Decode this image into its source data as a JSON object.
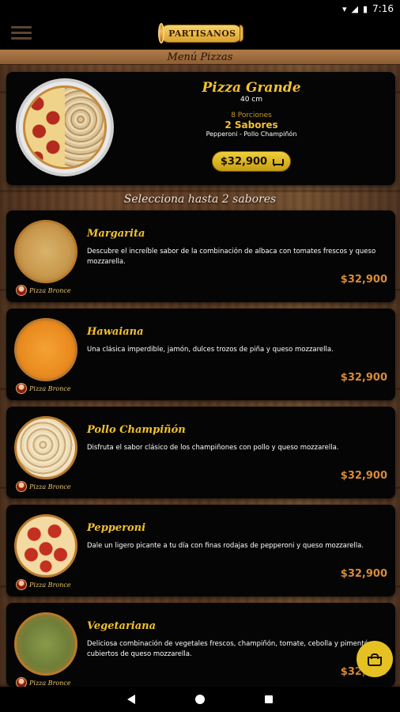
{
  "status_bar": {
    "time": "7:16"
  },
  "app_bar": {
    "logo_text": "PARTISANOS"
  },
  "section_title": "Menú Pizzas",
  "header": {
    "title": "Pizza Grande",
    "size": "40 cm",
    "portions": "8 Porciones",
    "flavors": "2 Sabores",
    "selected": "Pepperoni - Pollo Champiñón",
    "price": "$32,900"
  },
  "select_title": "Selecciona hasta 2 sabores",
  "products": [
    {
      "name": "Margarita",
      "description": "Descubre el increíble sabor de la combinación de albaca con tomates frescos y queso mozzarella.",
      "price": "$32,900",
      "badge": "Pizza Bronce"
    },
    {
      "name": "Hawaiana",
      "description": "Una clásica imperdible, jamón, dulces trozos de piña y queso mozzarella.",
      "price": "$32,900",
      "badge": "Pizza Bronce"
    },
    {
      "name": "Pollo Champiñón",
      "description": "Disfruta el sabor clásico de los champiñones con pollo y queso mozzarella.",
      "price": "$32,900",
      "badge": "Pizza Bronce"
    },
    {
      "name": "Pepperoni",
      "description": "Dale un ligero picante a tu día con finas rodajas de pepperoni y queso mozzarella.",
      "price": "$32,900",
      "badge": "Pizza Bronce"
    },
    {
      "name": "Vegetariana",
      "description": "Deliciosa combinación de vegetales frescos, champiñón, tomate, cebolla y pimentón cubiertos de queso mozzarella.",
      "price": "$32,900",
      "badge": "Pizza Bronce"
    }
  ],
  "colors": {
    "accent": "#f2c12e",
    "price": "#d98b36",
    "card": "#050505"
  }
}
